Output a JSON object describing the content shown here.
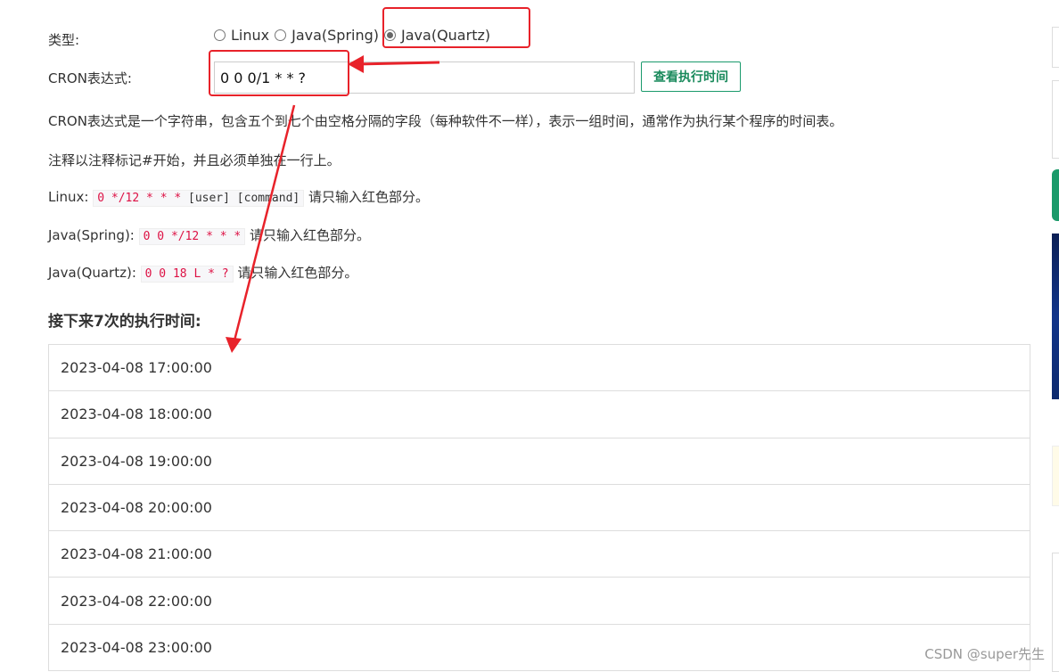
{
  "form": {
    "type_label": "类型:",
    "type_options": [
      {
        "label": "Linux",
        "checked": false
      },
      {
        "label": "Java(Spring)",
        "checked": false
      },
      {
        "label": "Java(Quartz)",
        "checked": true
      }
    ],
    "cron_label": "CRON表达式:",
    "cron_value": "0 0 0/1 * * ?",
    "view_button": "查看执行时间"
  },
  "info": {
    "line1": "CRON表达式是一个字符串，包含五个到七个由空格分隔的字段（每种软件不一样），表示一组时间，通常作为执行某个程序的时间表。",
    "line2": "注释以注释标记#开始，并且必须单独在一行上。",
    "linux_label": "Linux:",
    "linux_red": "0 */12 * * *",
    "linux_rest": " [user] [command]",
    "linux_hint": "请只输入红色部分。",
    "spring_label": "Java(Spring):",
    "spring_red": "0 0 */12 * * *",
    "spring_hint": "请只输入红色部分。",
    "quartz_label": "Java(Quartz):",
    "quartz_red": "0 0 18 L * ?",
    "quartz_hint": "请只输入红色部分。"
  },
  "results": {
    "heading": "接下来7次的执行时间:",
    "times": [
      "2023-04-08 17:00:00",
      "2023-04-08 18:00:00",
      "2023-04-08 19:00:00",
      "2023-04-08 20:00:00",
      "2023-04-08 21:00:00",
      "2023-04-08 22:00:00",
      "2023-04-08 23:00:00"
    ]
  },
  "watermark": "CSDN @super先生",
  "colors": {
    "annotation_red": "#e8222a",
    "button_green": "#1a8a5c",
    "code_red": "#dd1144"
  }
}
